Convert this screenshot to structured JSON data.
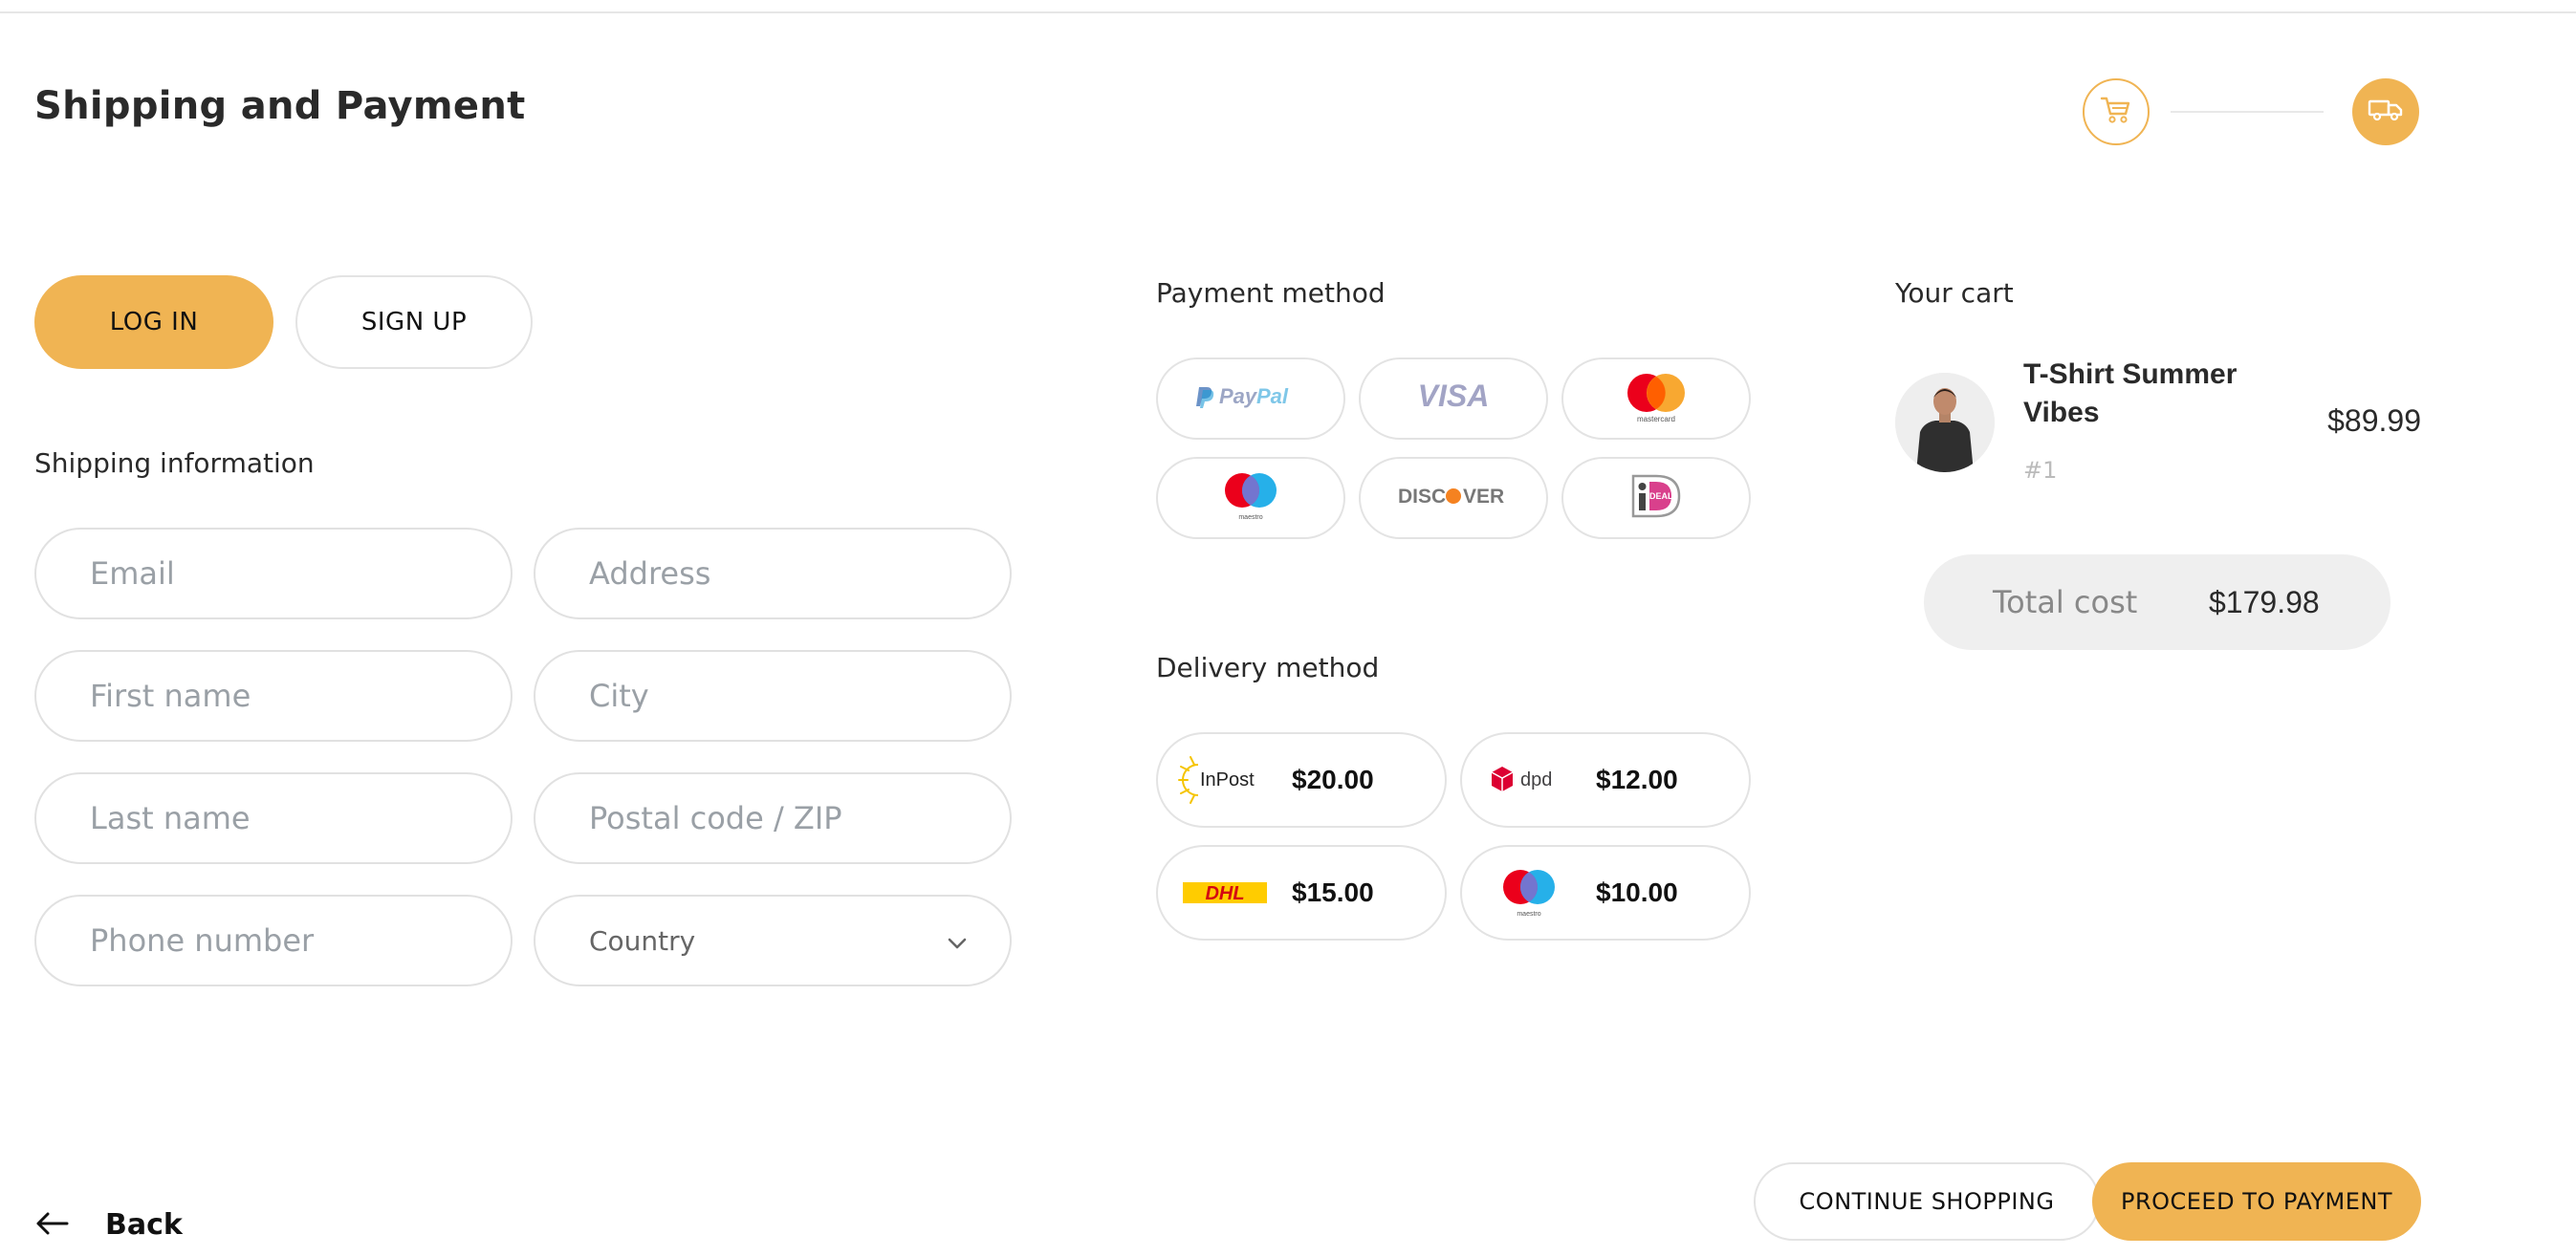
{
  "page": {
    "title": "Shipping and Payment"
  },
  "stepper": {
    "steps": [
      {
        "icon": "cart-icon"
      },
      {
        "icon": "truck-icon"
      }
    ],
    "active_color": "#f0b453"
  },
  "auth": {
    "login_label": "LOG IN",
    "signup_label": "SIGN UP"
  },
  "shipping": {
    "heading": "Shipping information",
    "fields": {
      "email": "Email",
      "address": "Address",
      "first_name": "First name",
      "city": "City",
      "last_name": "Last name",
      "postal": "Postal code / ZIP",
      "phone": "Phone number",
      "country": "Country"
    }
  },
  "payment": {
    "heading": "Payment method",
    "methods": [
      {
        "name": "PayPal",
        "icon": "paypal-logo"
      },
      {
        "name": "VISA",
        "icon": "visa-logo"
      },
      {
        "name": "mastercard",
        "icon": "mastercard-logo"
      },
      {
        "name": "maestro",
        "icon": "maestro-logo"
      },
      {
        "name": "DISCOVER",
        "icon": "discover-logo"
      },
      {
        "name": "iDEAL",
        "icon": "ideal-logo"
      }
    ]
  },
  "delivery": {
    "heading": "Delivery method",
    "options": [
      {
        "carrier": "InPost",
        "price": "$20.00"
      },
      {
        "carrier": "dpd",
        "price": "$12.00"
      },
      {
        "carrier": "DHL",
        "price": "$15.00"
      },
      {
        "carrier": "maestro",
        "price": "$10.00"
      }
    ]
  },
  "cart": {
    "heading": "Your cart",
    "items": [
      {
        "name": "T-Shirt Summer Vibes",
        "qty": "#1",
        "price": "$89.99"
      }
    ],
    "total_label": "Total cost",
    "total_value": "$179.98"
  },
  "actions": {
    "continue_label": "CONTINUE SHOPPING",
    "proceed_label": "PROCEED TO PAYMENT",
    "back_label": "Back"
  },
  "colors": {
    "accent": "#f0b453",
    "border": "#e3e3e3",
    "placeholder": "#9aa0a6"
  }
}
